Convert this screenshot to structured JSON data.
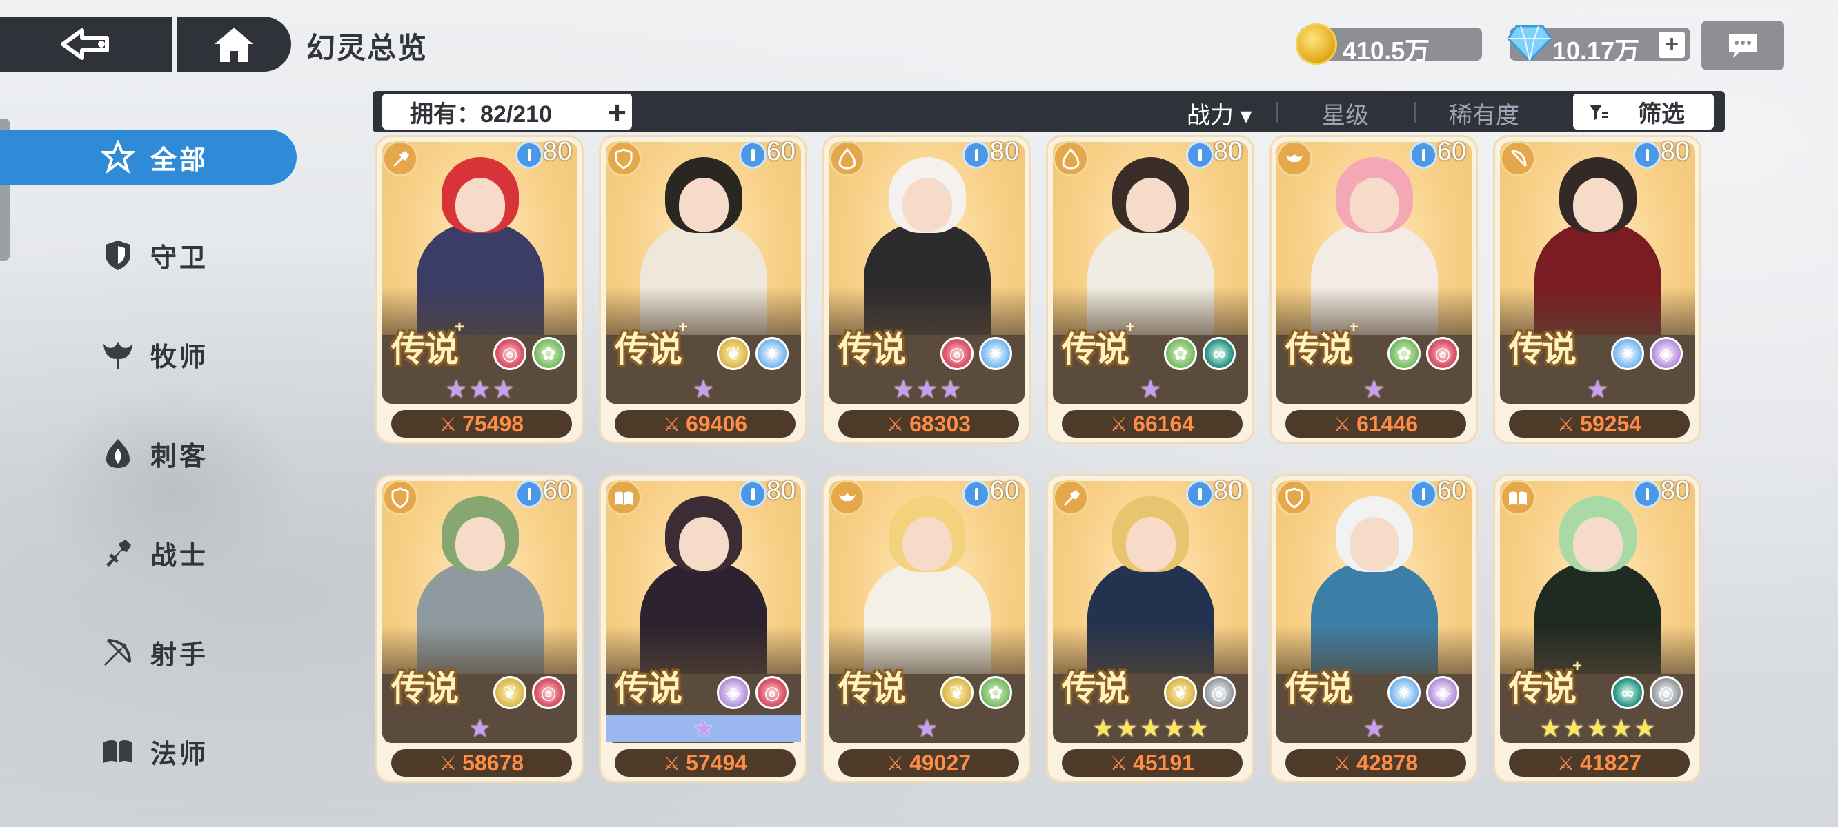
{
  "header": {
    "title": "幻灵总览",
    "gold": "410.5万",
    "gems": "10.17万"
  },
  "filter_bar": {
    "owned": "拥有：82/210",
    "sort_options": [
      "战力 ▾",
      "星级",
      "稀有度"
    ],
    "filter_label": "筛选"
  },
  "sidebar": {
    "items": [
      {
        "label": "全部",
        "icon": "all-icon"
      },
      {
        "label": "守卫",
        "icon": "guard-icon"
      },
      {
        "label": "牧师",
        "icon": "priest-icon"
      },
      {
        "label": "刺客",
        "icon": "assassin-icon"
      },
      {
        "label": "战士",
        "icon": "warrior-icon"
      },
      {
        "label": "射手",
        "icon": "archer-icon"
      },
      {
        "label": "法师",
        "icon": "mage-icon"
      }
    ]
  },
  "cards": [
    {
      "class": "warrior",
      "level": "80",
      "rarity": "传说",
      "plus": "+",
      "elements": [
        "red",
        "green"
      ],
      "stars": 3,
      "star_color": "purple",
      "power": "75498",
      "hair": "#d9333a",
      "body": "#3b3d66"
    },
    {
      "class": "guard",
      "level": "60",
      "rarity": "传说",
      "plus": "+",
      "elements": [
        "gold",
        "blue"
      ],
      "stars": 1,
      "star_color": "purple",
      "power": "69406",
      "hair": "#2a2622",
      "body": "#eee7dc"
    },
    {
      "class": "assassin",
      "level": "80",
      "rarity": "传说",
      "plus": "",
      "elements": [
        "red",
        "blue"
      ],
      "stars": 3,
      "star_color": "purple",
      "power": "68303",
      "hair": "#f4f1ee",
      "body": "#2d2b2e"
    },
    {
      "class": "assassin",
      "level": "80",
      "rarity": "传说",
      "plus": "+",
      "elements": [
        "green",
        "teal"
      ],
      "stars": 1,
      "star_color": "purple",
      "power": "66164",
      "hair": "#3a2d28",
      "body": "#f1ece2"
    },
    {
      "class": "priest",
      "level": "60",
      "rarity": "传说",
      "plus": "+",
      "elements": [
        "green",
        "red"
      ],
      "stars": 1,
      "star_color": "purple",
      "power": "61446",
      "hair": "#f4a8b6",
      "body": "#f3ece6"
    },
    {
      "class": "archer",
      "level": "80",
      "rarity": "传说",
      "plus": "",
      "elements": [
        "blue",
        "purple"
      ],
      "stars": 1,
      "star_color": "purple",
      "power": "59254",
      "hair": "#332a27",
      "body": "#7a1c22"
    },
    {
      "class": "guard",
      "level": "60",
      "rarity": "传说",
      "plus": "",
      "elements": [
        "gold",
        "red"
      ],
      "stars": 1,
      "star_color": "purple",
      "power": "58678",
      "hair": "#86a772",
      "body": "#8e9aa0"
    },
    {
      "class": "mage",
      "level": "80",
      "rarity": "传说",
      "plus": "",
      "elements": [
        "purple",
        "red"
      ],
      "stars": 1,
      "star_color": "purple",
      "power": "57494",
      "hair": "#3b2c36",
      "body": "#2d2330",
      "highlight": true
    },
    {
      "class": "priest",
      "level": "60",
      "rarity": "传说",
      "plus": "",
      "elements": [
        "gold",
        "green"
      ],
      "stars": 1,
      "star_color": "purple",
      "power": "49027",
      "hair": "#f3d27c",
      "body": "#f4f0e5"
    },
    {
      "class": "warrior",
      "level": "80",
      "rarity": "传说",
      "plus": "",
      "elements": [
        "gold",
        "gray"
      ],
      "stars": 5,
      "star_color": "gold",
      "power": "45191",
      "hair": "#e9c46e",
      "body": "#23324e"
    },
    {
      "class": "guard",
      "level": "60",
      "rarity": "传说",
      "plus": "",
      "elements": [
        "blue",
        "purple"
      ],
      "stars": 1,
      "star_color": "purple",
      "power": "42878",
      "hair": "#f2f2f2",
      "body": "#3c7fa6"
    },
    {
      "class": "mage",
      "level": "80",
      "rarity": "传说",
      "plus": "+",
      "elements": [
        "teal",
        "gray"
      ],
      "stars": 5,
      "star_color": "gold",
      "power": "41827",
      "hair": "#a9d9a4",
      "body": "#1f2a22"
    }
  ]
}
